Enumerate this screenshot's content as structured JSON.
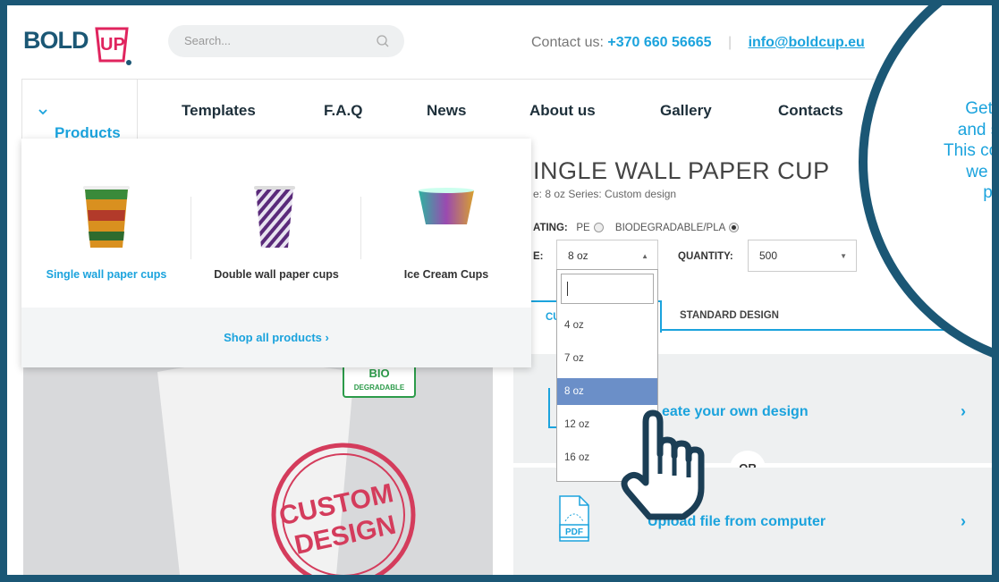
{
  "header": {
    "logo_text": "BOLD",
    "search_placeholder": "Search...",
    "contact_label": "Contact us:",
    "phone": "+370 660 56665",
    "separator": "|",
    "email": "info@boldcup.eu"
  },
  "nav": {
    "items": [
      "Products",
      "Templates",
      "F.A.Q",
      "News",
      "About us",
      "Gallery",
      "Contacts"
    ]
  },
  "products_menu": {
    "items": [
      "Single wall paper cups",
      "Double wall paper cups",
      "Ice Cream Cups"
    ],
    "shop_all": "Shop all products ›"
  },
  "product": {
    "title": "INGLE WALL PAPER CUP",
    "subtitle": "e: 8 oz   Series: Custom design",
    "coating_label": "ATING:",
    "coating_pe": "PE",
    "coating_bio": "BIODEGRADABLE/PLA",
    "size_label": "E:",
    "size_value": "8 oz",
    "quantity_label": "QUANTITY:",
    "quantity_value": "500",
    "badge_bio": "BIO",
    "badge_degradable": "DEGRADABLE",
    "stamp_line1": "CUSTOM",
    "stamp_line2": "DESIGN"
  },
  "size_dropdown": {
    "options": [
      "4 oz",
      "7 oz",
      "8 oz",
      "12 oz",
      "16 oz"
    ],
    "selected": "8 oz"
  },
  "tabs": {
    "custom": "CU",
    "standard": "STANDARD DESIGN"
  },
  "options": {
    "create": "eate your own design",
    "or": "OR",
    "upload": "Upload file from computer",
    "pdf": "PDF",
    "chevron": "›"
  },
  "bubble": {
    "lines": [
      "Get th",
      "and siz",
      "This coul",
      "we ha",
      "pop"
    ]
  }
}
